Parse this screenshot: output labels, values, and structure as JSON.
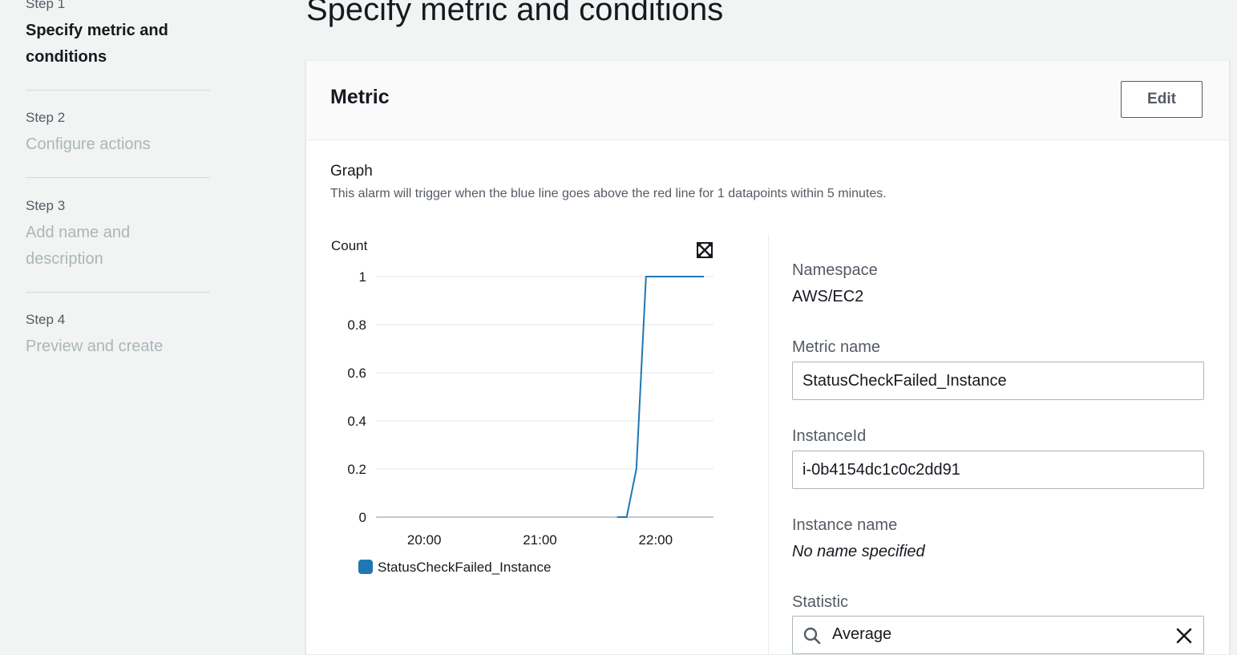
{
  "sidebar": {
    "steps": [
      {
        "label": "Step 1",
        "title": "Specify metric and conditions",
        "title_lines": [
          "Specify metric and",
          "conditions"
        ]
      },
      {
        "label": "Step 2",
        "title": "Configure actions"
      },
      {
        "label": "Step 3",
        "title": "Add name and description",
        "title_lines": [
          "Add name and",
          "description"
        ]
      },
      {
        "label": "Step 4",
        "title": "Preview and create"
      }
    ]
  },
  "page": {
    "title": "Specify metric and conditions"
  },
  "metric_card": {
    "title": "Metric",
    "edit_label": "Edit",
    "graph_heading": "Graph",
    "graph_description": "This alarm will trigger when the blue line goes above the red line for 1 datapoints within 5 minutes.",
    "expand_icon": "expand-icon"
  },
  "chart_data": {
    "type": "line",
    "ylabel": "Count",
    "ylim": [
      0,
      1
    ],
    "yticks": [
      "1",
      "0.8",
      "0.6",
      "0.4",
      "0.2",
      "0"
    ],
    "xticks": [
      "20:00",
      "21:00",
      "22:00"
    ],
    "grid": true,
    "legend": "bottom",
    "series": [
      {
        "name": "StatusCheckFailed_Instance",
        "color": "#1f77b4",
        "x": [
          "21:40",
          "21:45",
          "21:50",
          "21:55",
          "22:00",
          "22:05",
          "22:10",
          "22:15",
          "22:20",
          "22:25"
        ],
        "y": [
          0,
          0,
          0.2,
          1,
          1,
          1,
          1,
          1,
          1,
          1
        ]
      }
    ]
  },
  "details": {
    "namespace_label": "Namespace",
    "namespace_value": "AWS/EC2",
    "metric_name_label": "Metric name",
    "metric_name_value": "StatusCheckFailed_Instance",
    "instance_id_label": "InstanceId",
    "instance_id_value": "i-0b4154dc1c0c2dd91",
    "instance_name_label": "Instance name",
    "instance_name_value": "No name specified",
    "statistic_label": "Statistic",
    "statistic_value": "Average",
    "search_icon": "search-icon",
    "clear_icon": "close-icon"
  }
}
